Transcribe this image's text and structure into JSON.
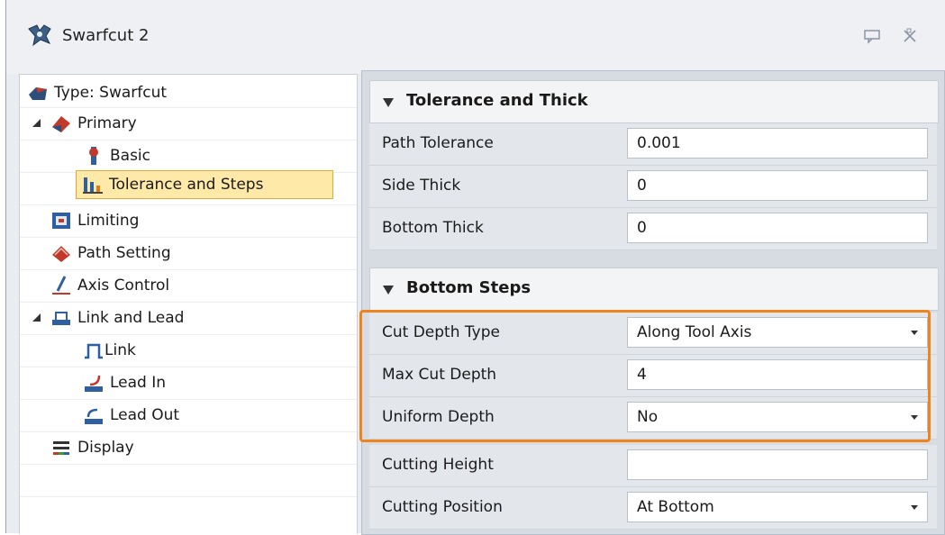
{
  "window": {
    "title": "Swarfcut 2",
    "pin_icon": "speech-bubble-icon",
    "close_icon": "close-icon"
  },
  "tree": {
    "items": [
      {
        "label": "Type: Swarfcut",
        "icon": "swarfcut-type-icon"
      },
      {
        "label": "Primary",
        "icon": "primary-icon"
      },
      {
        "label": "Basic",
        "icon": "basic-icon"
      },
      {
        "label": "Tolerance and Steps",
        "icon": "tolerance-steps-icon",
        "selected": true
      },
      {
        "label": "Limiting",
        "icon": "limiting-icon"
      },
      {
        "label": "Path Setting",
        "icon": "path-setting-icon"
      },
      {
        "label": "Axis Control",
        "icon": "axis-control-icon"
      },
      {
        "label": "Link and Lead",
        "icon": "link-lead-icon"
      },
      {
        "label": "Link",
        "icon": "link-icon"
      },
      {
        "label": "Lead In",
        "icon": "lead-in-icon"
      },
      {
        "label": "Lead Out",
        "icon": "lead-out-icon"
      },
      {
        "label": "Display",
        "icon": "display-icon"
      }
    ]
  },
  "sections": {
    "tolerance": {
      "title": "Tolerance and Thick",
      "rows": [
        {
          "label": "Path Tolerance",
          "value": "0.001"
        },
        {
          "label": "Side Thick",
          "value": "0"
        },
        {
          "label": "Bottom Thick",
          "value": "0"
        }
      ]
    },
    "bottom_steps": {
      "title": "Bottom Steps",
      "rows": [
        {
          "label": "Cut Depth Type",
          "value": "Along Tool Axis",
          "dropdown": true
        },
        {
          "label": "Max Cut Depth",
          "value": "4"
        },
        {
          "label": "Uniform Depth",
          "value": "No",
          "dropdown": true
        },
        {
          "label": "Cutting Height",
          "value": ""
        },
        {
          "label": "Cutting Position",
          "value": "At Bottom",
          "dropdown": true
        }
      ]
    }
  },
  "colors": {
    "highlight": "#f0841c",
    "selection": "#ffe9a8"
  }
}
